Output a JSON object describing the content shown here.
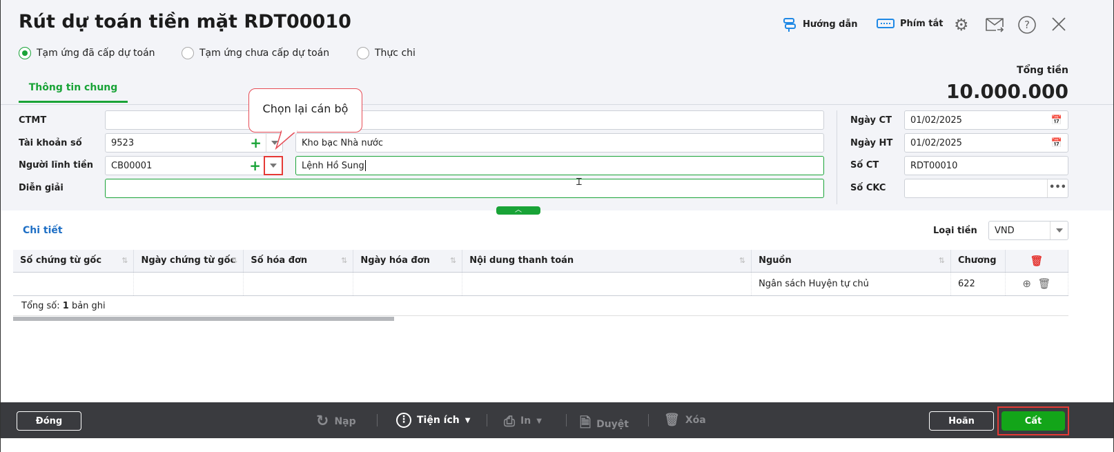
{
  "title": "Rút dự toán tiền mặt RDT00010",
  "header": {
    "guide": "Hướng dẫn",
    "shortcuts": "Phím tắt"
  },
  "radios": [
    {
      "label": "Tạm ứng đã cấp dự toán",
      "checked": true
    },
    {
      "label": "Tạm ứng chưa cấp dự toán",
      "checked": false
    },
    {
      "label": "Thực chi",
      "checked": false
    }
  ],
  "total": {
    "label": "Tổng tiền",
    "value": "10.000.000"
  },
  "tab": "Thông tin chung",
  "tooltip": "Chọn lại cán bộ",
  "form": {
    "ctmt": {
      "label": "CTMT",
      "value": ""
    },
    "account": {
      "label": "Tài khoản số",
      "code": "9523",
      "name": "Kho bạc Nhà nước"
    },
    "receiver": {
      "label": "Người lĩnh tiền",
      "code": "CB00001",
      "name": "Lệnh Hồ Sung"
    },
    "desc": {
      "label": "Diễn giải",
      "value": ""
    },
    "date_ct": {
      "label": "Ngày CT",
      "value": "01/02/2025"
    },
    "date_ht": {
      "label": "Ngày HT",
      "value": "01/02/2025"
    },
    "so_ct": {
      "label": "Số CT",
      "value": "RDT00010"
    },
    "so_ckc": {
      "label": "Số CKC",
      "value": ""
    }
  },
  "detail": {
    "title": "Chi tiết",
    "currency_label": "Loại tiền",
    "currency": "VND"
  },
  "table": {
    "columns": [
      "Số chứng từ gốc",
      "Ngày chứng từ gốc",
      "Số hóa đơn",
      "Ngày hóa đơn",
      "Nội dung thanh toán",
      "Nguồn",
      "Chương"
    ],
    "rows": [
      [
        "",
        "",
        "",
        "",
        "",
        "Ngân sách Huyện tự chủ",
        "622"
      ]
    ],
    "footer_prefix": "Tổng số: ",
    "footer_count": "1",
    "footer_suffix": " bản ghi"
  },
  "toolbar": {
    "close": "Đóng",
    "reload": "Nạp",
    "utilities": "Tiện ích",
    "print": "In",
    "approve": "Duyệt",
    "delete": "Xóa",
    "cancel": "Hoãn",
    "save": "Cất"
  }
}
